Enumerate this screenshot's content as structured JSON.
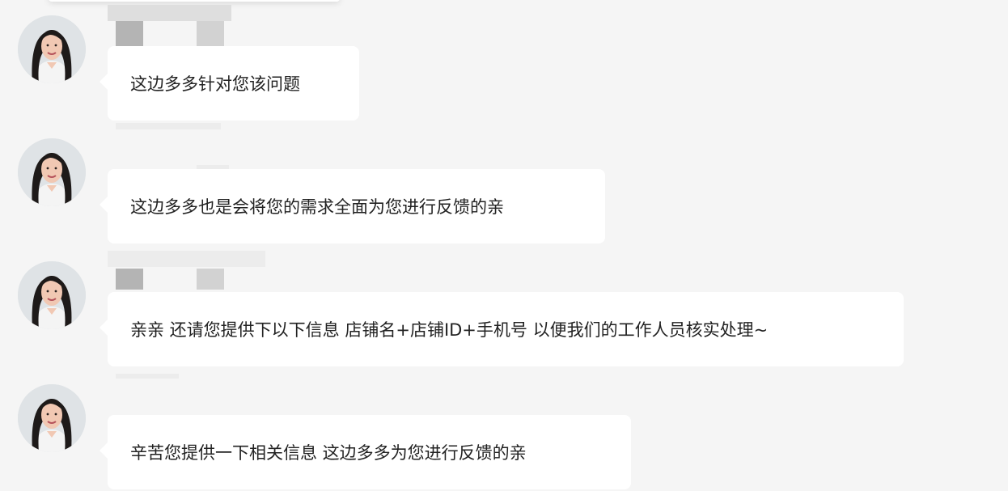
{
  "chat": {
    "messages": [
      {
        "text": "这边多多针对您该问题",
        "sender_redacted": true
      },
      {
        "text": "这边多多也是会将您的需求全面为您进行反馈的亲",
        "sender_redacted": true
      },
      {
        "text": "亲亲 还请您提供下以下信息 店铺名+店铺ID+手机号 以便我们的工作人员核实处理~",
        "sender_redacted": true
      },
      {
        "text": "辛苦您提供一下相关信息 这边多多为您进行反馈的亲",
        "sender_redacted": true
      }
    ]
  },
  "icons": {
    "avatar": "agent-avatar-photo"
  },
  "colors": {
    "background": "#f5f5f5",
    "bubble": "#ffffff",
    "text": "#222222"
  }
}
